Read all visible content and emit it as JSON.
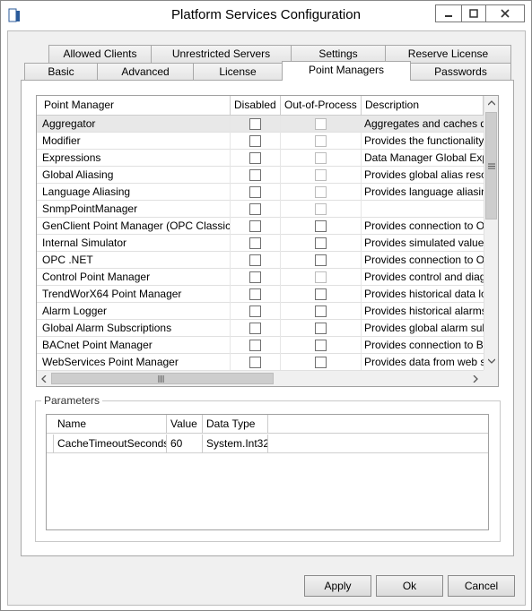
{
  "window": {
    "title": "Platform Services Configuration"
  },
  "caption_buttons": {
    "minimize": "▁",
    "maximize": "▢",
    "close": "✕"
  },
  "tabs_row1": [
    "Allowed Clients",
    "Unrestricted Servers",
    "Settings",
    "Reserve License"
  ],
  "tabs_row2": [
    "Basic",
    "Advanced",
    "License",
    "Point Managers",
    "Passwords"
  ],
  "active_tab": "Point Managers",
  "grid": {
    "columns": [
      "Point Manager",
      "Disabled",
      "Out-of-Process",
      "Description"
    ],
    "rows": [
      {
        "name": "Aggregator",
        "oop_enabled": false,
        "desc": "Aggregates and caches d"
      },
      {
        "name": "Modifier",
        "oop_enabled": false,
        "desc": "Provides the functionality"
      },
      {
        "name": "Expressions",
        "oop_enabled": false,
        "desc": "Data Manager Global Exp"
      },
      {
        "name": "Global Aliasing",
        "oop_enabled": false,
        "desc": "Provides global alias reso"
      },
      {
        "name": "Language Aliasing",
        "oop_enabled": false,
        "desc": "Provides language aliasin"
      },
      {
        "name": "SnmpPointManager",
        "oop_enabled": false,
        "desc": ""
      },
      {
        "name": "GenClient Point Manager (OPC Classic)",
        "oop_enabled": true,
        "desc": "Provides connection to O"
      },
      {
        "name": "Internal Simulator",
        "oop_enabled": true,
        "desc": "Provides simulated value"
      },
      {
        "name": "OPC .NET",
        "oop_enabled": true,
        "desc": "Provides connection to O"
      },
      {
        "name": "Control Point Manager",
        "oop_enabled": false,
        "desc": "Provides control and diag"
      },
      {
        "name": "TrendWorX64 Point Manager",
        "oop_enabled": true,
        "desc": "Provides historical data lo"
      },
      {
        "name": "Alarm Logger",
        "oop_enabled": true,
        "desc": "Provides historical alarms"
      },
      {
        "name": "Global Alarm Subscriptions",
        "oop_enabled": true,
        "desc": "Provides global alarm sub"
      },
      {
        "name": "BACnet Point Manager",
        "oop_enabled": true,
        "desc": "Provides connection to B"
      },
      {
        "name": "WebServices Point Manager",
        "oop_enabled": true,
        "desc": "Provides data from web s"
      }
    ]
  },
  "parameters": {
    "label": "Parameters",
    "columns": [
      "Name",
      "Value",
      "Data Type"
    ],
    "rows": [
      {
        "name": "CacheTimeoutSeconds",
        "value": "60",
        "type": "System.Int32"
      }
    ]
  },
  "buttons": {
    "apply": "Apply",
    "ok": "Ok",
    "cancel": "Cancel"
  }
}
